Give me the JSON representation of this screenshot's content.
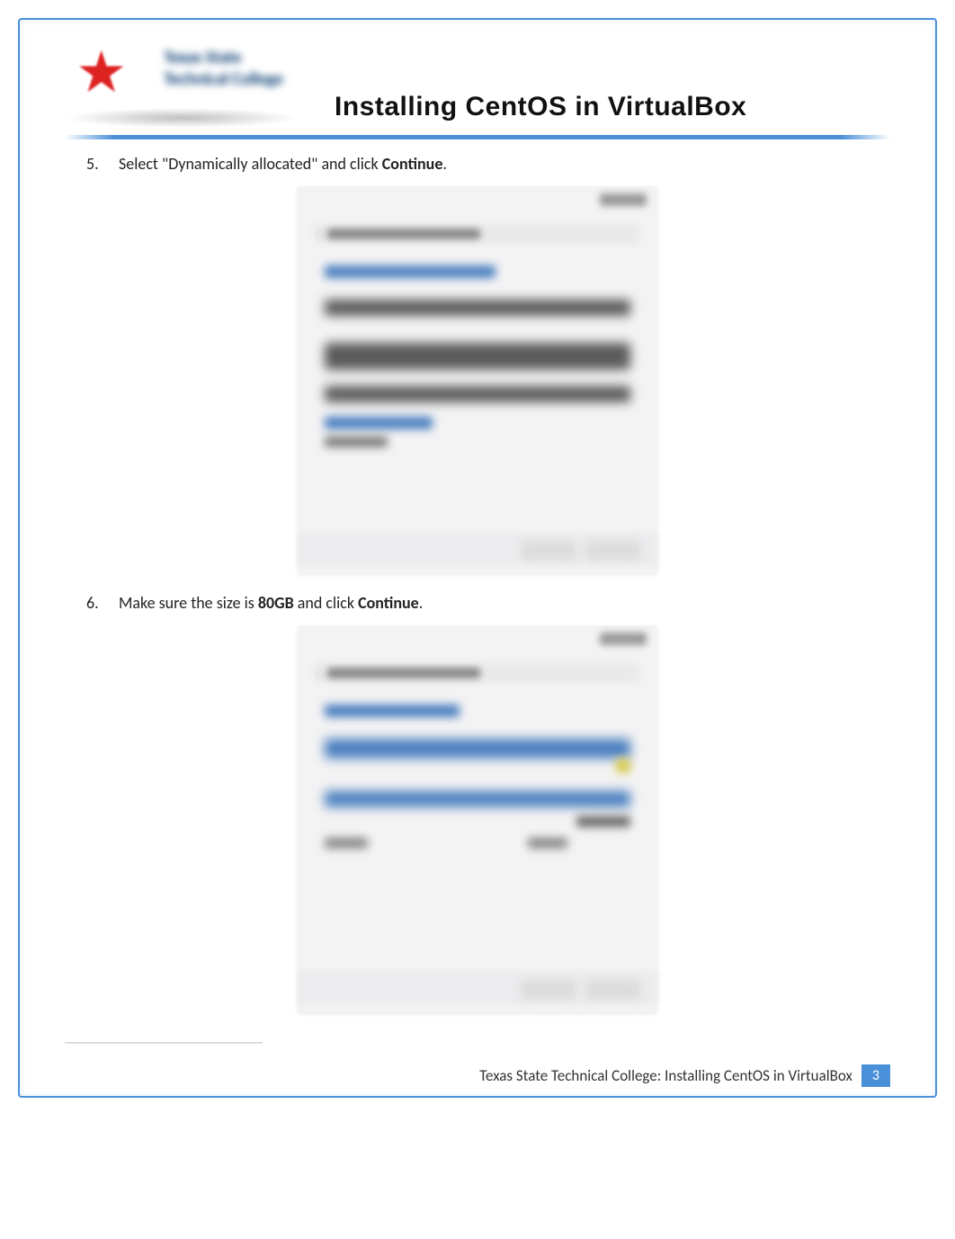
{
  "logo": {
    "alt": "Texas State Technical College"
  },
  "title": "Installing CentOS in VirtualBox",
  "steps": [
    {
      "num": "5.",
      "pre": "Select \"Dynamically allocated\" and click ",
      "bold": "Continue",
      "post": "."
    },
    {
      "num": "6.",
      "pre": "Make sure the size is ",
      "bold1": "80GB",
      "mid": " and click ",
      "bold2": "Continue",
      "post": "."
    }
  ],
  "screenshots": [
    {
      "caption": "VirtualBox Create Virtual Hard Disk — Storage on physical hard disk (Dynamically allocated / Fixed size)"
    },
    {
      "caption": "VirtualBox Create Virtual Hard Disk — File location and size (80.00 GB)"
    }
  ],
  "footer": {
    "text": "Texas State Technical College:   Installing CentOS in VirtualBox",
    "page": "3"
  }
}
